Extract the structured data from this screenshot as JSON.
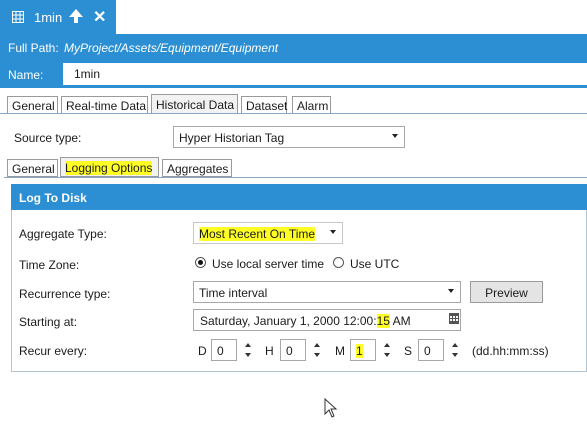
{
  "window": {
    "title": "1min"
  },
  "path": {
    "label": "Full Path:",
    "value": "MyProject/Assets/Equipment/Equipment"
  },
  "name": {
    "label": "Name:",
    "value": "1min"
  },
  "main_tabs": [
    "General",
    "Real-time Data",
    "Historical Data",
    "Dataset",
    "Alarm"
  ],
  "main_tab_active": "Historical Data",
  "source": {
    "label": "Source type:",
    "value": "Hyper Historian Tag"
  },
  "sub_tabs": [
    "General",
    "Logging Options",
    "Aggregates"
  ],
  "sub_tab_active": "Logging Options",
  "log": {
    "title": "Log To Disk",
    "aggregate": {
      "label": "Aggregate Type:",
      "value": "Most Recent On Time"
    },
    "timezone": {
      "label": "Time Zone:",
      "option_local": "Use local server time",
      "option_utc": "Use UTC",
      "selected": "Use local server time"
    },
    "recurrence": {
      "label": "Recurrence type:",
      "value": "Time interval",
      "preview_label": "Preview"
    },
    "starting": {
      "label": "Starting at:",
      "value_pre": "Saturday, January 1, 2000 12:00:",
      "value_hl": "15",
      "value_post": " AM"
    },
    "recur": {
      "label": "Recur every:",
      "d_label": "D",
      "d_value": "0",
      "h_label": "H",
      "h_value": "0",
      "m_label": "M",
      "m_value": "1",
      "s_label": "S",
      "s_value": "0",
      "format": "(dd.hh:mm:ss)"
    }
  },
  "colors": {
    "accent": "#2c8fd3",
    "highlight": "#ffff26"
  },
  "icons": [
    "grid-icon",
    "pin-up-icon",
    "close-icon",
    "dropdown-arrow-icon",
    "calendar-icon",
    "spin-up-icon",
    "spin-down-icon",
    "mouse-cursor-icon"
  ]
}
